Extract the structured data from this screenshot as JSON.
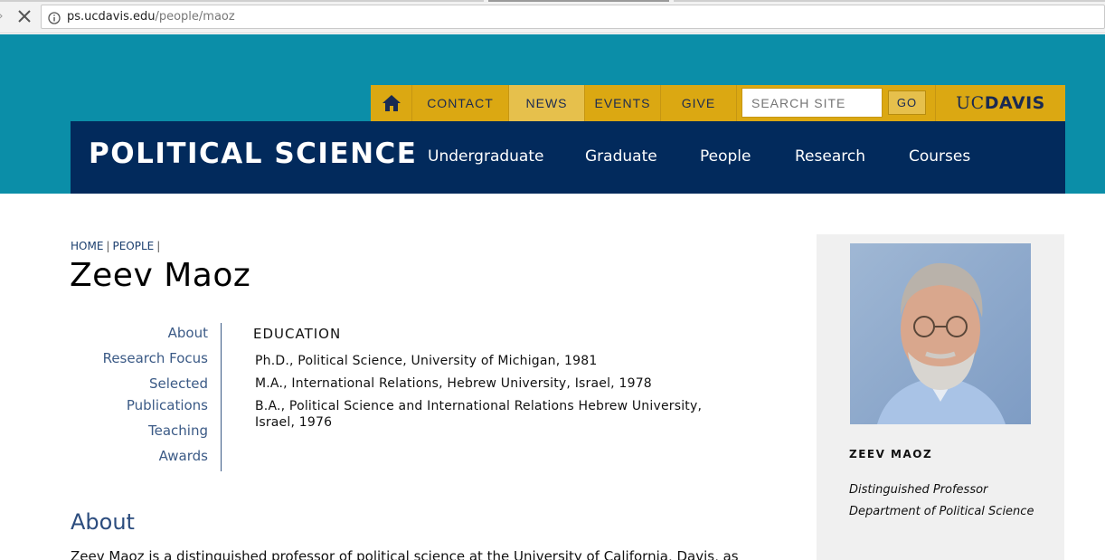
{
  "browser": {
    "url_domain": "ps.ucdavis.edu",
    "url_path": "/people/maoz"
  },
  "utility_nav": {
    "items": [
      {
        "label": "CONTACT",
        "active": false
      },
      {
        "label": "NEWS",
        "active": true
      },
      {
        "label": "EVENTS",
        "active": false
      },
      {
        "label": "GIVE",
        "active": false
      }
    ],
    "search_placeholder": "SEARCH SITE",
    "go_label": "GO",
    "logo_uc": "UC",
    "logo_davis": "DAVIS"
  },
  "site": {
    "title": "POLITICAL SCIENCE",
    "nav": [
      "Undergraduate",
      "Graduate",
      "People",
      "Research",
      "Courses"
    ]
  },
  "breadcrumb": [
    "HOME",
    "PEOPLE"
  ],
  "page": {
    "title": "Zeev Maoz"
  },
  "side_tabs": [
    "About",
    "Research Focus",
    "Selected",
    "Publications",
    "Teaching",
    "Awards"
  ],
  "education": {
    "heading": "EDUCATION",
    "items": [
      "Ph.D., Political Science, University of Michigan, 1981",
      "M.A., International Relations, Hebrew University, Israel, 1978",
      "B.A., Political Science and International Relations Hebrew University, Israel, 1976"
    ]
  },
  "about": {
    "heading": "About",
    "text": "Zeev Maoz is a distinguished professor of political science at the University of California, Davis, as"
  },
  "profile": {
    "name": "ZEEV MAOZ",
    "role_1": "Distinguished Professor",
    "role_2": "Department of Political Science"
  },
  "colors": {
    "teal_band": "#0b8ea8",
    "gold": "#dba812",
    "navy": "#022a5c",
    "link_blue": "#3b5a86"
  }
}
